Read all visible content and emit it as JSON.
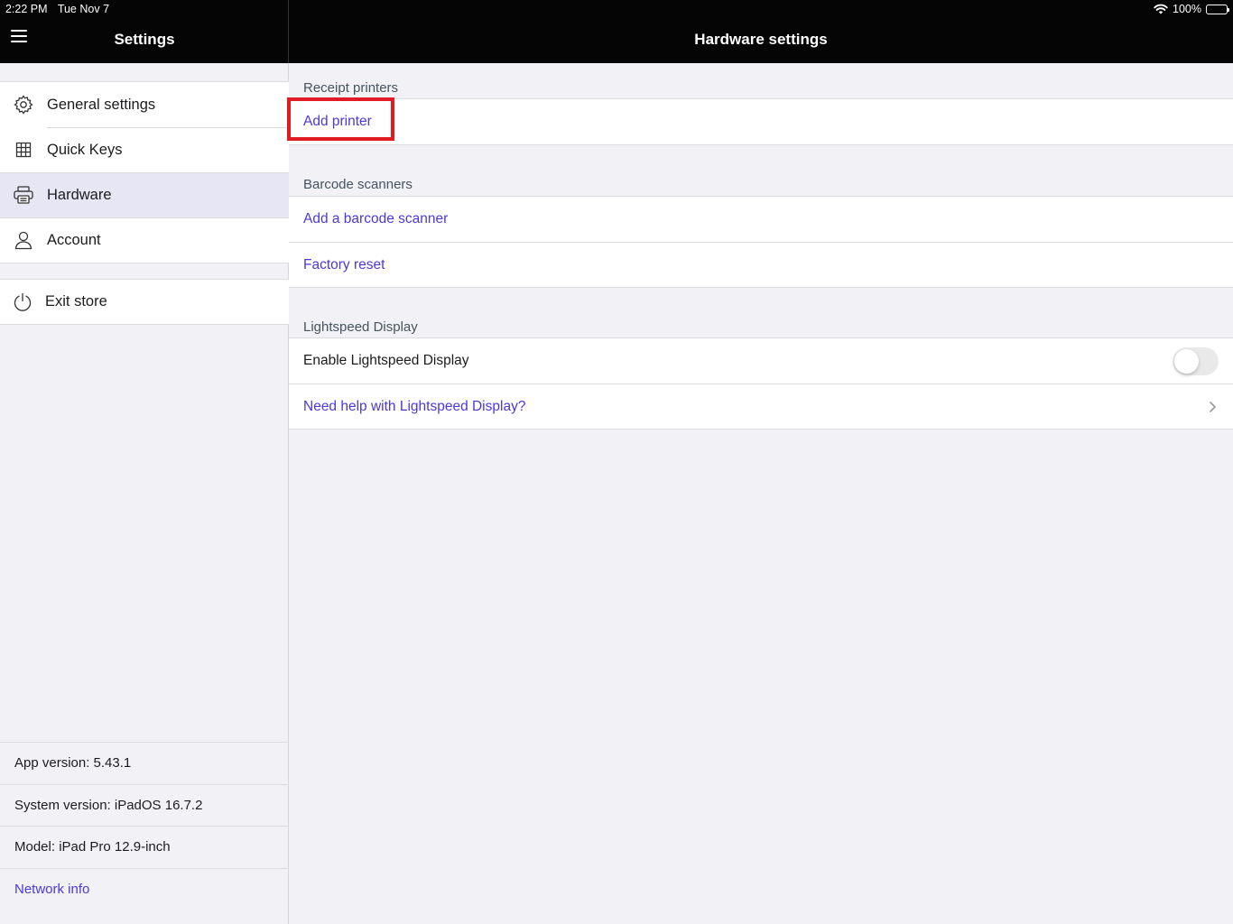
{
  "status_bar": {
    "time": "2:22 PM",
    "date": "Tue Nov 7",
    "battery": "100%"
  },
  "nav": {
    "left_title": "Settings",
    "right_title": "Hardware settings"
  },
  "sidebar": {
    "items": [
      {
        "label": "General settings",
        "icon": "gear-icon"
      },
      {
        "label": "Quick Keys",
        "icon": "grid-icon"
      },
      {
        "label": "Hardware",
        "icon": "printer-icon",
        "active": true
      },
      {
        "label": "Account",
        "icon": "user-icon"
      }
    ],
    "exit": {
      "label": "Exit store",
      "icon": "power-icon"
    },
    "info": {
      "app_version": "App version: 5.43.1",
      "system_version": "System version: iPadOS 16.7.2",
      "model": "Model: iPad Pro 12.9-inch",
      "network_info": "Network info"
    }
  },
  "main": {
    "receipt_printers": {
      "header": "Receipt printers",
      "add_printer": "Add printer"
    },
    "barcode_scanners": {
      "header": "Barcode scanners",
      "add_scanner": "Add a barcode scanner",
      "factory_reset": "Factory reset"
    },
    "lightspeed_display": {
      "header": "Lightspeed Display",
      "enable_label": "Enable Lightspeed Display",
      "enabled": false,
      "help_link": "Need help with Lightspeed Display?"
    }
  },
  "colors": {
    "accent": "#4a39d6",
    "highlight": "#e01b24",
    "active_bg": "#e7e6f5",
    "battery": "#34c759"
  }
}
